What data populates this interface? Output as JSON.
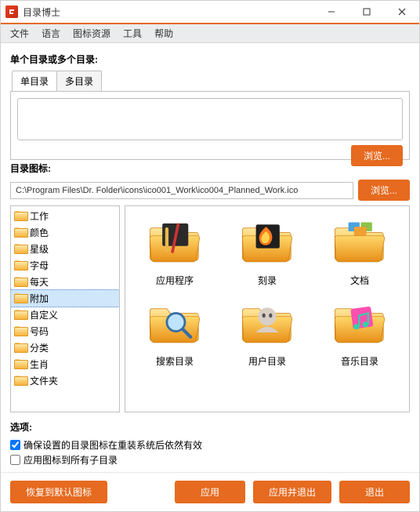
{
  "window": {
    "title": "目录博士"
  },
  "menubar": [
    "文件",
    "语言",
    "图标资源",
    "工具",
    "帮助"
  ],
  "section1_label": "单个目录或多个目录:",
  "tabs": {
    "single": "单目录",
    "multi": "多目录"
  },
  "browse_label": "浏览...",
  "icon_section_label": "目录图标:",
  "icon_path": "C:\\Program Files\\Dr. Folder\\icons\\ico001_Work\\ico004_Planned_Work.ico",
  "tree_items": [
    "工作",
    "颜色",
    "星级",
    "字母",
    "每天",
    "附加",
    "自定义",
    "号码",
    "分类",
    "生肖",
    "文件夹"
  ],
  "tree_selected_index": 5,
  "grid_items": [
    {
      "label": "应用程序",
      "icon": "apps"
    },
    {
      "label": "刻录",
      "icon": "burn"
    },
    {
      "label": "文档",
      "icon": "docs"
    },
    {
      "label": "搜索目录",
      "icon": "search"
    },
    {
      "label": "用户目录",
      "icon": "users"
    },
    {
      "label": "音乐目录",
      "icon": "music"
    }
  ],
  "options": {
    "label": "选项:",
    "opt1": "确保设置的目录图标在重装系统后依然有效",
    "opt1_checked": true,
    "opt2": "应用图标到所有子目录",
    "opt2_checked": false
  },
  "footer": {
    "restore": "恢复到默认图标",
    "apply": "应用",
    "apply_exit": "应用并退出",
    "exit": "退出"
  }
}
